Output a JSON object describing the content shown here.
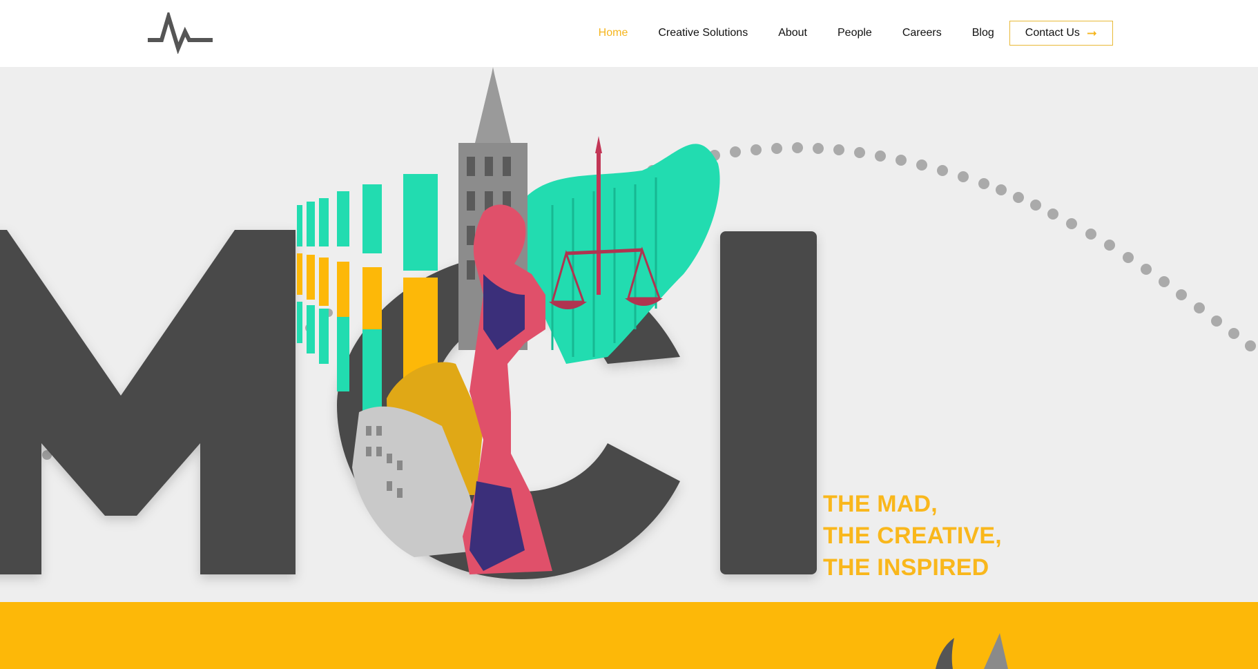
{
  "header": {
    "logo_icon": "mci-pulse-logo-icon",
    "nav": [
      {
        "label": "Home",
        "active": true
      },
      {
        "label": "Creative Solutions",
        "active": false
      },
      {
        "label": "About",
        "active": false
      },
      {
        "label": "People",
        "active": false
      },
      {
        "label": "Careers",
        "active": false
      },
      {
        "label": "Blog",
        "active": false
      }
    ],
    "contact_label": "Contact Us",
    "contact_icon": "arrow-right-icon"
  },
  "hero": {
    "tagline": [
      "THE MAD,",
      "THE CREATIVE,",
      "THE INSPIRED"
    ],
    "artwork": "mci-letters-collage"
  },
  "colors": {
    "accent": "#f9b71c",
    "band": "#fdb808",
    "letters": "#4a4a4a",
    "teal": "#22dcb0",
    "hero_bg": "#eeeeee"
  }
}
